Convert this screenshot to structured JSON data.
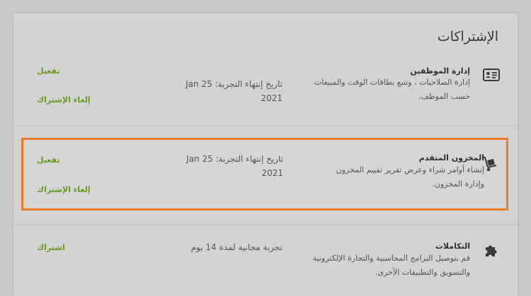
{
  "page": {
    "title": "الإشتراكات"
  },
  "subscriptions": [
    {
      "icon": "id-card-icon",
      "name": "إدارة الموظفين",
      "description": "إدارة الصلاحيات ، وتتبع بطاقات الوقت والمبيعات حسب الموظف.",
      "status_text": "تاريخ إنتهاء التجربة: Jan 25 2021",
      "actions": [
        "تفعيل",
        "إلغاء الإشتراك"
      ]
    },
    {
      "icon": "dolly-cart-icon",
      "name": "المخزون المتقدم",
      "description": "إنشاء أوامر شراء وعرض تقرير تقييم المخزون وإدارة المخزون.",
      "status_text": "تاريخ إنتهاء التجربة: Jan 25 2021",
      "actions": [
        "تفعيل",
        "إلغاء الإشتراك"
      ]
    },
    {
      "icon": "puzzle-icon",
      "name": "التكاملات",
      "description": "قم بتوصيل البرامج المحاسبية والتجارة الإلكترونية والتسويق والتطبيقات الأخرى.",
      "status_text": "تجربة مجانية لمدة 14 يوم",
      "actions": [
        "اشتراك"
      ]
    }
  ]
}
